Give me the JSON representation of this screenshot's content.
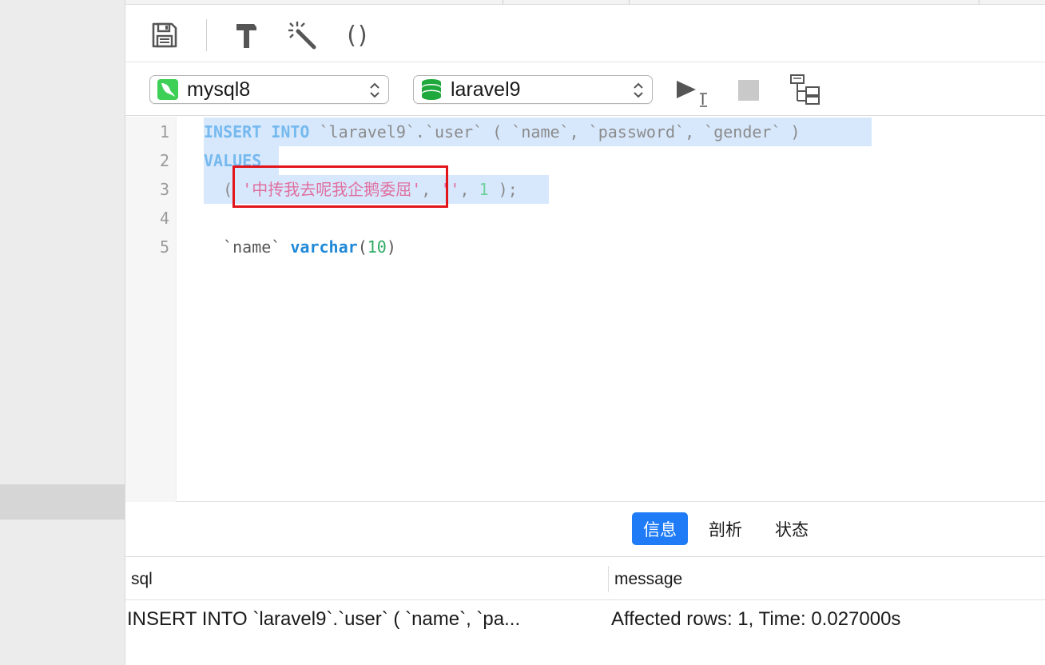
{
  "toolbar": {
    "items": [
      {
        "name": "save-icon"
      },
      {
        "name": "hammer-icon"
      },
      {
        "name": "magic-wand-icon"
      },
      {
        "name": "parentheses-icon",
        "glyph": "()"
      }
    ]
  },
  "connection": {
    "server_label": "mysql8",
    "database_label": "laravel9",
    "server_icon": "mysql-dolphin-icon",
    "database_icon": "database-stack-icon",
    "server_icon_color": "#3ecf57",
    "database_icon_color": "#1fa83c"
  },
  "editor": {
    "line_numbers": [
      "1",
      "2",
      "3",
      "4",
      "5"
    ],
    "lines": {
      "l1_kw1": "INSERT",
      "l1_kw2": "INTO",
      "l1_rest": "`laravel9`.`user` ( `name`, `password`, `gender` )",
      "l2_kw": "VALUES",
      "l3_open": "( ",
      "l3_str": "'中抟我去呢我企鹅委屈'",
      "l3_mid": ", ",
      "l3_str2": "''",
      "l3_sep": ", ",
      "l3_num": "1",
      "l3_close": " );",
      "l5_col": "`name`",
      "l5_type": "varchar",
      "l5_open": "(",
      "l5_num": "10",
      "l5_close": ")"
    }
  },
  "result_tabs": {
    "info": "信息",
    "profile": "剖析",
    "status": "状态",
    "active": "info",
    "accent_color": "#1f7cf6"
  },
  "result_table": {
    "columns": [
      "sql",
      "message"
    ],
    "rows": [
      {
        "sql": "INSERT INTO `laravel9`.`user` ( `name`, `pa...",
        "message": "Affected rows: 1, Time: 0.027000s"
      }
    ]
  },
  "highlight_color": "#e2151a"
}
